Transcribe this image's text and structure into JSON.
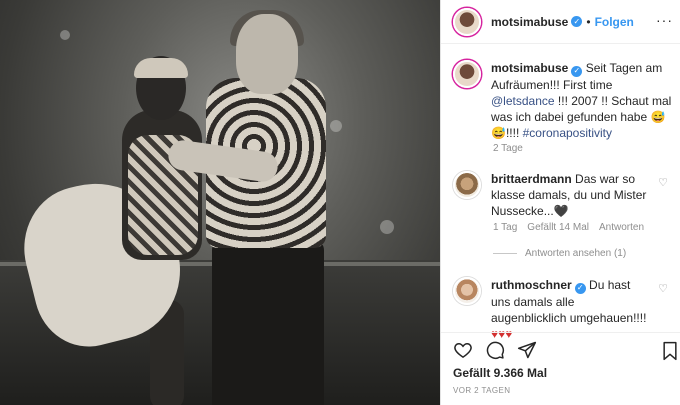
{
  "header": {
    "username": "motsimabuse",
    "separator": "•",
    "follow_label": "Folgen",
    "more_glyph": "···"
  },
  "caption": {
    "username": "motsimabuse",
    "text_before": " Seit Tagen am Aufräumen!!! First time ",
    "mention": "@letsdance",
    "text_after": " !!! 2007 !! Schaut mal was ich dabei gefunden habe 😅😅!!!! ",
    "hashtag": "#coronapositivity",
    "time": "2 Tage"
  },
  "comments": [
    {
      "username": "brittaerdmann",
      "text": " Das war so klasse damals, du und Mister Nussecke...🖤",
      "time": "1 Tag",
      "likes": "Gefällt 14 Mal",
      "reply_label": "Antworten",
      "view_replies": "Antworten ansehen (1)"
    },
    {
      "username": "ruthmoschner",
      "text": " Du hast uns damals alle augenblicklich umgehauen!!!! ",
      "hearts": "♥♥♥"
    }
  ],
  "footer": {
    "likes": "Gefällt 9.366 Mal",
    "date": "VOR 2 TAGEN"
  },
  "icons": [
    "heart-icon",
    "comment-icon",
    "share-icon",
    "bookmark-icon",
    "verified-icon",
    "more-icon"
  ],
  "colors": {
    "link": "#385185",
    "follow": "#3897f0",
    "verified": "#3897f0",
    "muted": "#8e8e8e"
  }
}
